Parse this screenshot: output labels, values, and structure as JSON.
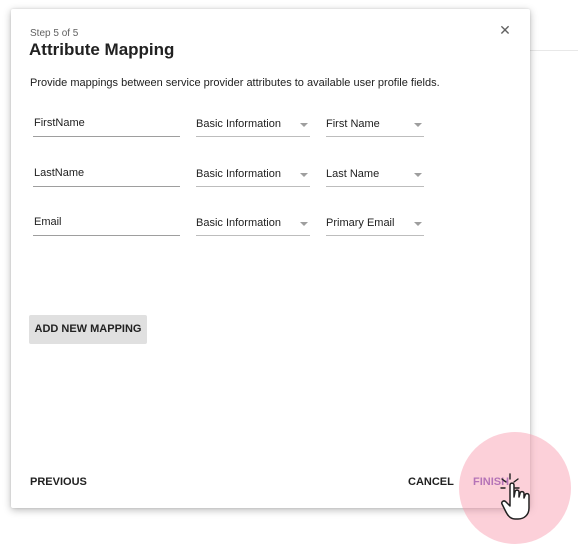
{
  "dialog": {
    "step": "Step 5 of 5",
    "title": "Attribute Mapping",
    "description": "Provide mappings between service provider attributes to available user profile fields.",
    "close_icon": "close-icon"
  },
  "mappings": [
    {
      "attribute": "FirstName",
      "category": "Basic Information",
      "field": "First Name"
    },
    {
      "attribute": "LastName",
      "category": "Basic Information",
      "field": "Last Name"
    },
    {
      "attribute": "Email",
      "category": "Basic Information",
      "field": "Primary Email"
    }
  ],
  "actions": {
    "add_mapping": "ADD NEW MAPPING",
    "previous": "PREVIOUS",
    "cancel": "CANCEL",
    "finish": "FINISH"
  },
  "colors": {
    "accent": "#7e57c2",
    "touch_indicator": "#f896aa"
  },
  "icons": {
    "cursor": "pointing-hand-icon",
    "dropdown": "chevron-down-icon"
  }
}
